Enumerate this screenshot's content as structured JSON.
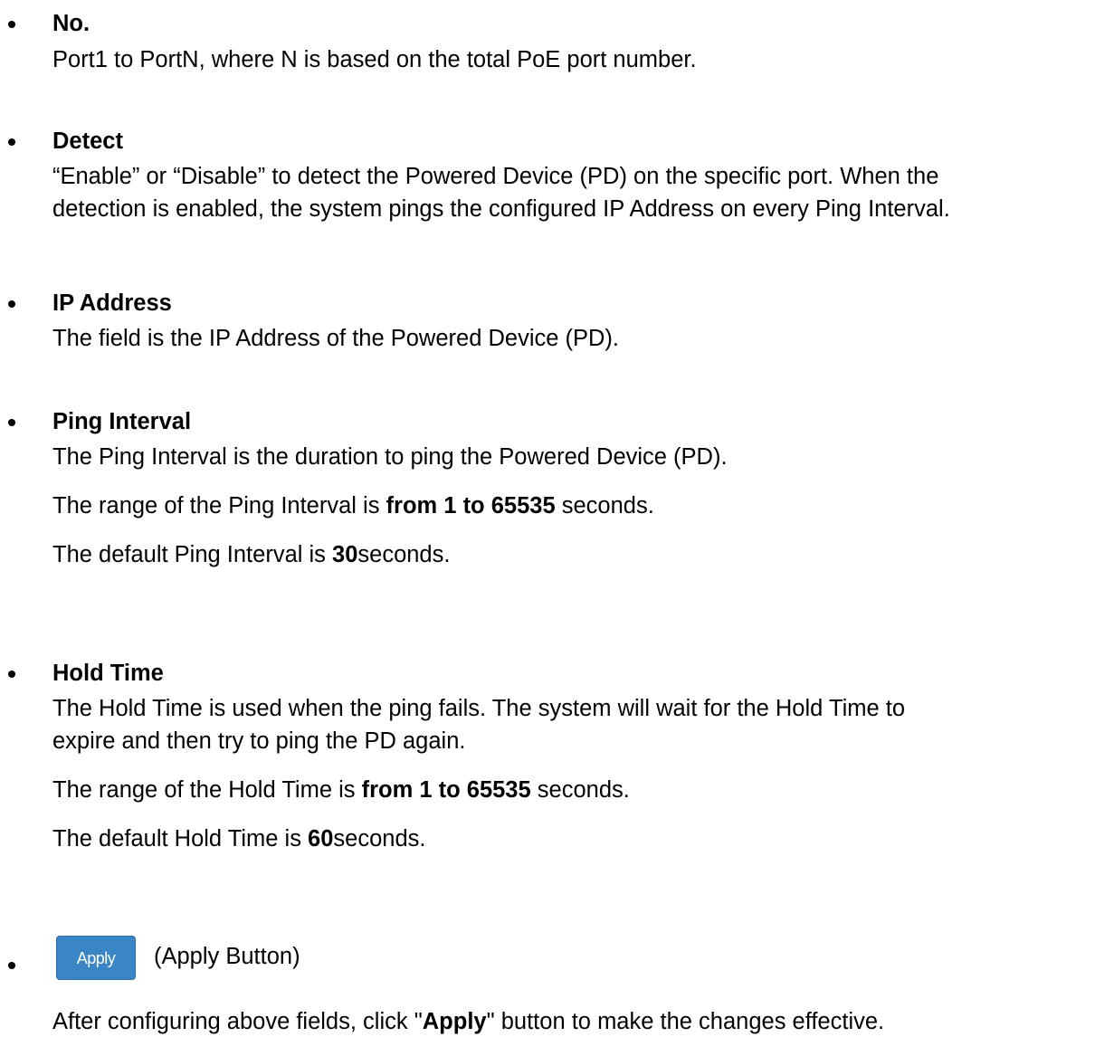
{
  "items": [
    {
      "term": "No.",
      "lines": [
        "Port1 to PortN, where N is based on the total PoE port number."
      ]
    },
    {
      "term": "Detect",
      "lines": [
        "“Enable” or “Disable” to detect the Powered Device (PD) on the specific port. When the",
        "detection is enabled, the system pings the configured IP Address on every Ping Interval."
      ]
    },
    {
      "term": "IP Address",
      "lines": [
        "The field is the IP Address of the Powered Device (PD)."
      ]
    },
    {
      "term": "Ping Interval",
      "lines": [
        "The Ping Interval is the duration to ping the Powered Device (PD)."
      ],
      "range": {
        "pre": "The range of the Ping Interval is ",
        "bold": "from 1 to 65535",
        "post": " seconds."
      },
      "default": {
        "pre": "The default Ping Interval is ",
        "bold": "30",
        "post": "seconds."
      }
    },
    {
      "term": "Hold Time",
      "lines": [
        "The Hold Time is used when the ping fails. The system will wait for the Hold Time to",
        "expire and then try to ping the PD again."
      ],
      "range": {
        "pre": "The range of the Hold Time is ",
        "bold": "from 1 to 65535",
        "post": " seconds."
      },
      "default": {
        "pre": "The default Hold Time is ",
        "bold": "60",
        "post": "seconds."
      }
    }
  ],
  "apply": {
    "button_label": "Apply",
    "caption": "(Apply Button)",
    "desc_pre": "After configuring above fields, click \"",
    "desc_bold": "Apply",
    "desc_post": "\" button to make the changes effective.",
    "button_color": "#3a85c6"
  }
}
